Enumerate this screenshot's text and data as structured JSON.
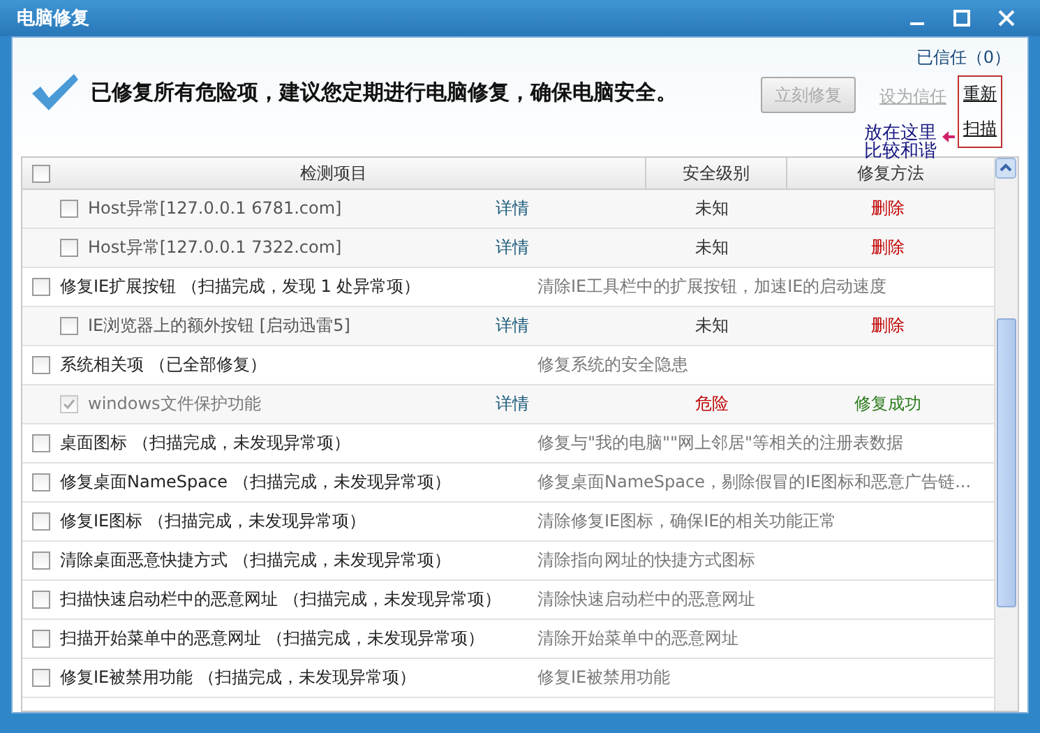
{
  "window": {
    "title": "电脑修复"
  },
  "header": {
    "trusted_link": "已信任（0）",
    "message": "已修复所有危险项，建议您定期进行电脑修复，确保电脑安全。",
    "fix_button": {
      "label": "立刻修复",
      "disabled": true
    },
    "trust_link": {
      "label": "设为信任",
      "disabled": true
    },
    "rescan_link": [
      "重新",
      "扫描"
    ]
  },
  "annotation": {
    "lines": [
      "放在这里",
      "比较和谐"
    ]
  },
  "table": {
    "select_all": {
      "checked": false
    },
    "columns": [
      "检测项目",
      "安全级别",
      "修复方法"
    ],
    "rows": [
      {
        "kind": "sub",
        "label": "Host异常[127.0.0.1 6781.com]",
        "checked": false,
        "disabled": false,
        "detail": "详情",
        "safety": "未知",
        "danger": false,
        "action": "删除",
        "fixed": false
      },
      {
        "kind": "sub",
        "label": "Host异常[127.0.0.1 7322.com]",
        "checked": false,
        "disabled": false,
        "detail": "详情",
        "safety": "未知",
        "danger": false,
        "action": "删除",
        "fixed": false
      },
      {
        "kind": "group",
        "label": "修复IE扩展按钮 （扫描完成，发现 1 处异常项）",
        "checked": false,
        "description": "清除IE工具栏中的扩展按钮，加速IE的启动速度"
      },
      {
        "kind": "sub",
        "label": "IE浏览器上的额外按钮 [启动迅雷5]",
        "checked": false,
        "disabled": false,
        "detail": "详情",
        "safety": "未知",
        "danger": false,
        "action": "删除",
        "fixed": false
      },
      {
        "kind": "group",
        "label": "系统相关项 （已全部修复）",
        "checked": false,
        "description": "修复系统的安全隐患"
      },
      {
        "kind": "sub",
        "label": "windows文件保护功能",
        "checked": true,
        "disabled": true,
        "detail": "详情",
        "safety": "危险",
        "danger": true,
        "action": "修复成功",
        "fixed": true
      },
      {
        "kind": "group",
        "label": "桌面图标 （扫描完成，未发现异常项）",
        "checked": false,
        "description": "修复与\"我的电脑\"\"网上邻居\"等相关的注册表数据"
      },
      {
        "kind": "group",
        "label": "修复桌面NameSpace （扫描完成，未发现异常项）",
        "checked": false,
        "description": "修复桌面NameSpace，剔除假冒的IE图标和恶意广告链..."
      },
      {
        "kind": "group",
        "label": "修复IE图标 （扫描完成，未发现异常项）",
        "checked": false,
        "description": "清除修复IE图标，确保IE的相关功能正常"
      },
      {
        "kind": "group",
        "label": "清除桌面恶意快捷方式 （扫描完成，未发现异常项）",
        "checked": false,
        "description": "清除指向网址的快捷方式图标"
      },
      {
        "kind": "group",
        "label": "扫描快速启动栏中的恶意网址 （扫描完成，未发现异常项）",
        "checked": false,
        "description": "清除快速启动栏中的恶意网址"
      },
      {
        "kind": "group",
        "label": "扫描开始菜单中的恶意网址 （扫描完成，未发现异常项）",
        "checked": false,
        "description": "清除开始菜单中的恶意网址"
      },
      {
        "kind": "group",
        "label": "修复IE被禁用功能 （扫描完成，未发现异常项）",
        "checked": false,
        "description": "修复IE被禁用功能"
      }
    ]
  }
}
